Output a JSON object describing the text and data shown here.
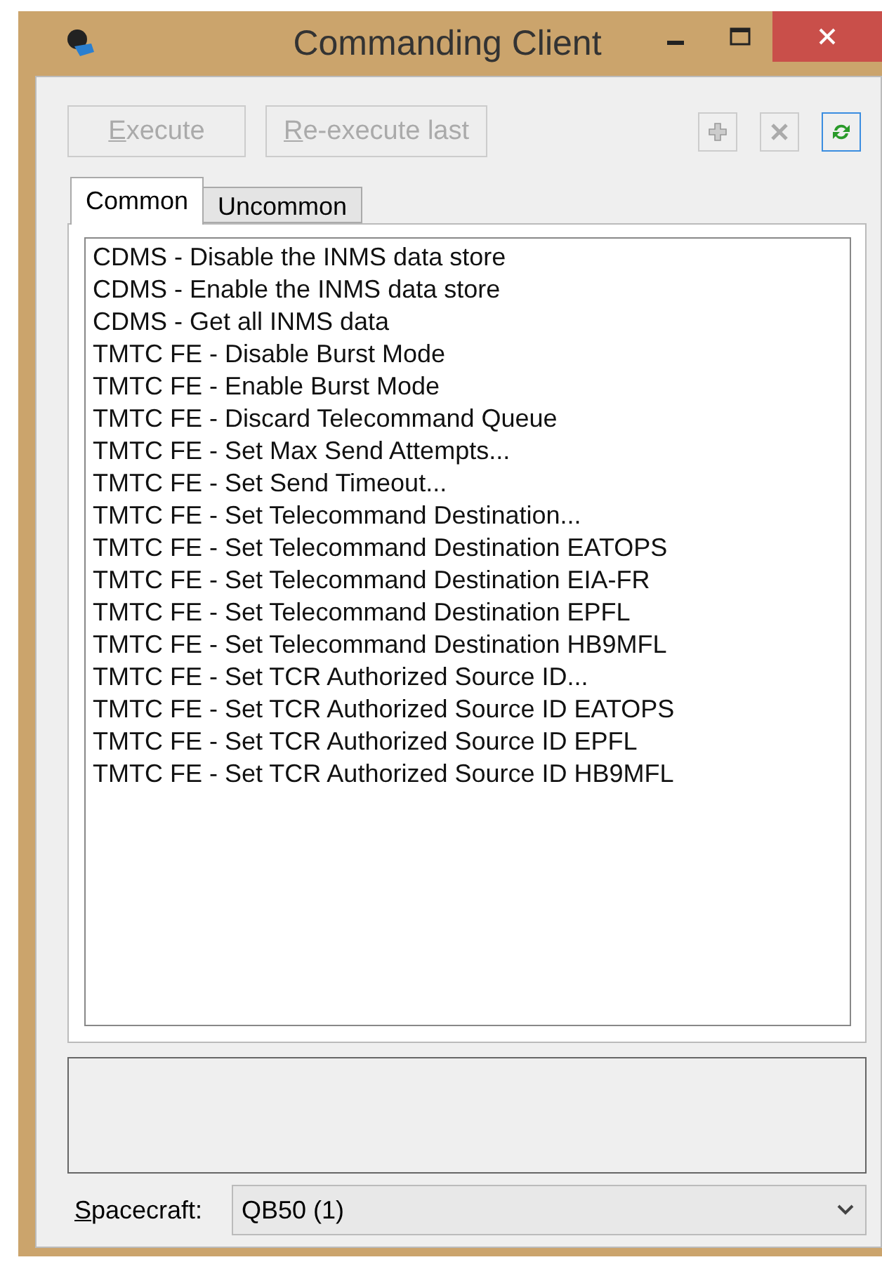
{
  "window": {
    "title": "Commanding Client"
  },
  "toolbar": {
    "buttons": [
      {
        "label": "Execute",
        "disabled": true
      },
      {
        "label": "Re-execute last",
        "disabled": true
      }
    ],
    "icon_buttons": [
      {
        "kind": "add",
        "disabled": true,
        "selected": false
      },
      {
        "kind": "remove",
        "disabled": true,
        "selected": false
      },
      {
        "kind": "refresh",
        "disabled": false,
        "selected": true
      }
    ]
  },
  "tabs": [
    {
      "label": "Common",
      "selected": true
    },
    {
      "label": "Uncommon",
      "selected": false
    }
  ],
  "commands": [
    "CDMS - Disable the INMS data store",
    "CDMS - Enable the INMS data store",
    "CDMS - Get all INMS data",
    "TMTC FE - Disable Burst Mode",
    "TMTC FE - Enable Burst Mode",
    "TMTC FE - Discard Telecommand Queue",
    "TMTC FE - Set Max Send Attempts...",
    "TMTC FE - Set Send Timeout...",
    "TMTC FE - Set Telecommand Destination...",
    "TMTC FE - Set Telecommand Destination EATOPS",
    "TMTC FE - Set Telecommand Destination EIA-FR",
    "TMTC FE - Set Telecommand Destination EPFL",
    "TMTC FE - Set Telecommand Destination HB9MFL",
    "TMTC FE - Set TCR Authorized Source ID...",
    "TMTC FE - Set TCR Authorized Source ID EATOPS",
    "TMTC FE - Set TCR Authorized Source ID EPFL",
    "TMTC FE - Set TCR Authorized Source ID HB9MFL"
  ],
  "spacecraft": {
    "label": "Spacecraft:",
    "value": "QB50 (1)"
  }
}
